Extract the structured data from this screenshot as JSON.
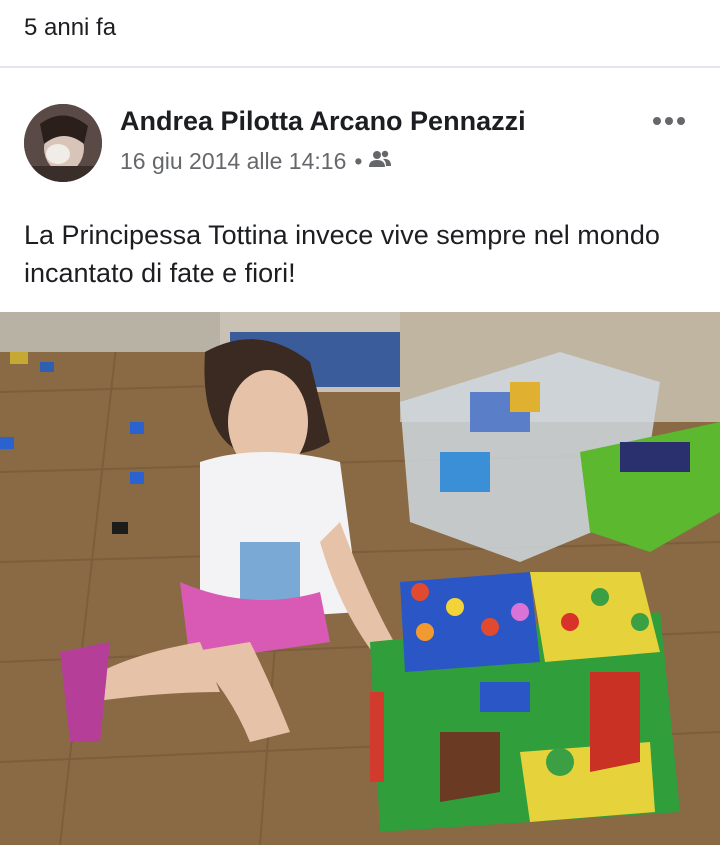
{
  "memory": {
    "time_ago": "5 anni fa"
  },
  "post": {
    "author": "Andrea Pilotta Arcano Pennazzi",
    "timestamp": "16 giu 2014 alle 14:16",
    "separator": "•",
    "audience_icon": "friends-icon",
    "more_icon": "more-options-icon",
    "text": "La Principessa Tottina invece vive sempre nel mondo incantato di fate e fiori!"
  },
  "colors": {
    "text": "#1c1e21",
    "secondary": "#65676b",
    "divider": "#e4e6eb",
    "background": "#ffffff"
  }
}
